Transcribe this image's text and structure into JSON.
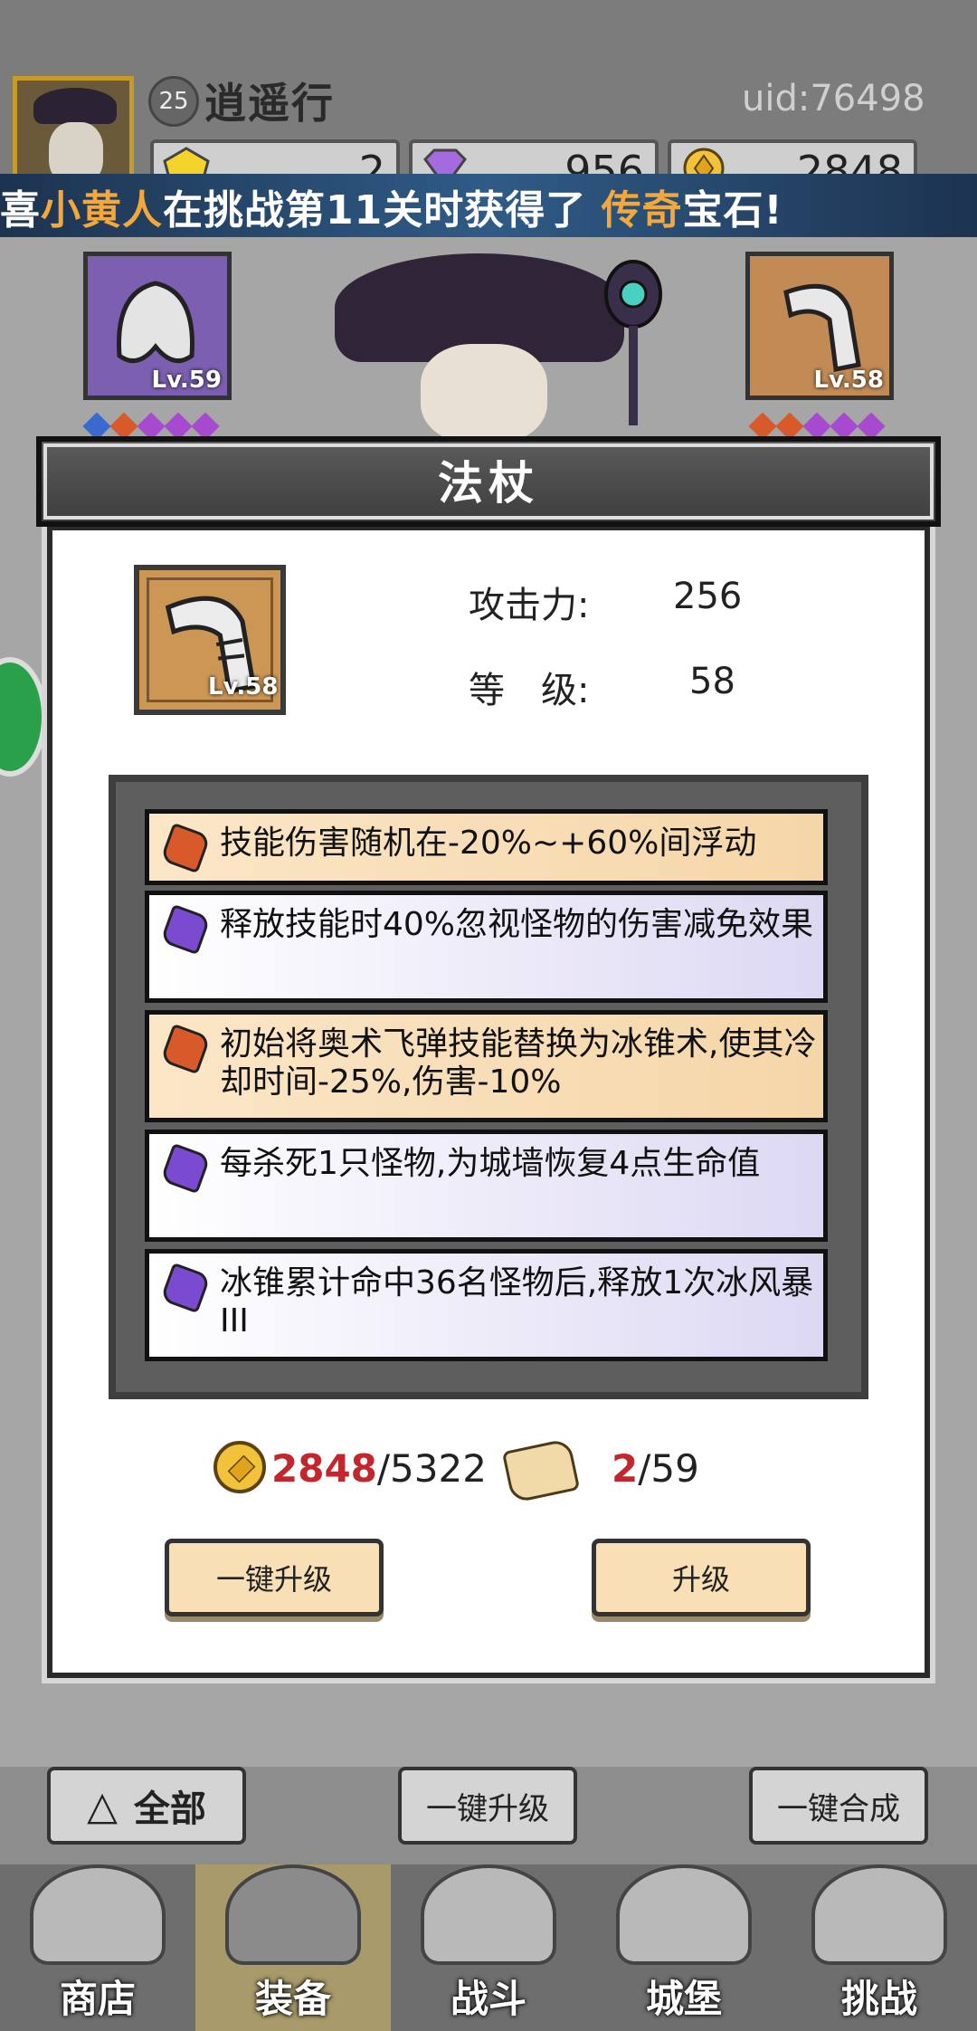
{
  "header": {
    "player_level": "25",
    "player_name": "逍遥行",
    "uid": "uid:76498",
    "resources": [
      {
        "icon": "yellow-gem-icon",
        "value": "2"
      },
      {
        "icon": "purple-diamond-icon",
        "value": "956"
      },
      {
        "icon": "gold-coin-icon",
        "value": "2848"
      }
    ]
  },
  "banner": {
    "prefix": "喜",
    "player": "小黄人",
    "middle": "在挑战第11关时获得了",
    "rarity": "传奇",
    "suffix": "宝石!"
  },
  "equip_slots": {
    "left_level": "Lv.59",
    "right_level": "Lv.58"
  },
  "dialog": {
    "title": "法杖",
    "item_level_badge": "Lv.58",
    "stats": [
      {
        "label": "攻击力:",
        "value": "256"
      },
      {
        "label": "等　级:",
        "value": "58"
      }
    ],
    "traits": [
      {
        "color": "orange",
        "text": "技能伤害随机在-20%~+60%间浮动"
      },
      {
        "color": "purple",
        "text": "释放技能时40%忽视怪物的伤害减免效果"
      },
      {
        "color": "orange",
        "text": "初始将奥术飞弹技能替换为冰锥术,使其冷却时间-25%,伤害-10%"
      },
      {
        "color": "purple",
        "text": "每杀死1只怪物,为城墙恢复4点生命值"
      },
      {
        "color": "purple",
        "text": "冰锥累计命中36名怪物后,释放1次冰风暴III"
      }
    ],
    "gold_have": "2848",
    "gold_need": "/5322",
    "scroll_have": "2",
    "scroll_need": "/59",
    "one_key_upgrade": "一键升级",
    "upgrade": "升级"
  },
  "controls": {
    "filter_all": "全部",
    "one_key_upgrade": "一键升级",
    "one_key_merge": "一键合成"
  },
  "nav": [
    {
      "label": "商店",
      "icon": "shop-icon"
    },
    {
      "label": "装备",
      "icon": "backpack-icon"
    },
    {
      "label": "战斗",
      "icon": "crossed-swords-icon"
    },
    {
      "label": "城堡",
      "icon": "castle-icon"
    },
    {
      "label": "挑战",
      "icon": "shield-icon"
    }
  ],
  "colors": {
    "accent_orange": "#f4a73a",
    "have_red": "#c1272d",
    "banner_blue": "#2f5b86"
  }
}
